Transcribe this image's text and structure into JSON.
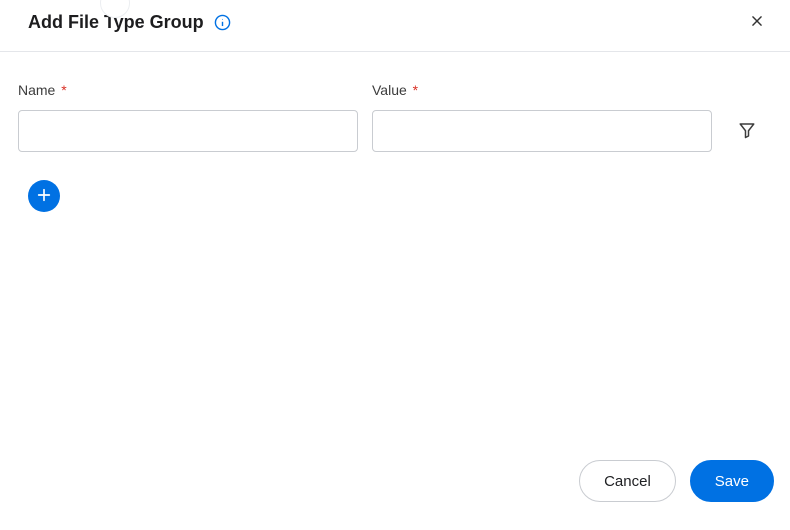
{
  "header": {
    "title": "Add File Type Group"
  },
  "fields": {
    "name": {
      "label": "Name",
      "required_mark": "*",
      "value": ""
    },
    "value": {
      "label": "Value",
      "required_mark": "*",
      "value": ""
    }
  },
  "footer": {
    "cancel_label": "Cancel",
    "save_label": "Save"
  }
}
